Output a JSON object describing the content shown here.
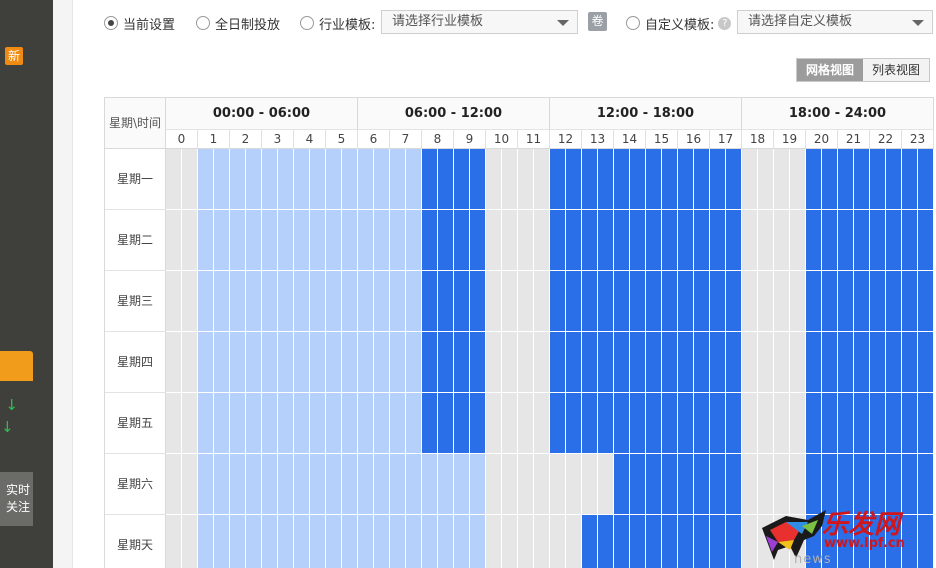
{
  "sidebar": {
    "new_badge": "新",
    "arrows": [
      "↓",
      "↓"
    ],
    "button_text": "实时\n关注"
  },
  "top_row": {
    "options": [
      {
        "label": "当前设置",
        "checked": true
      },
      {
        "label": "全日制投放",
        "checked": false
      },
      {
        "label": "行业模板:",
        "checked": false
      },
      {
        "label": "自定义模板:",
        "checked": false
      }
    ],
    "industry_select_placeholder": "请选择行业模板",
    "custom_select_placeholder": "请选择自定义模板",
    "tag_label": "卷",
    "help_icon": "?"
  },
  "view_toggle": {
    "grid_label": "网格视图",
    "list_label": "列表视图",
    "active": "grid"
  },
  "grid": {
    "corner_label": "星期\\时间",
    "hour_groups": [
      "00:00 - 06:00",
      "06:00 - 12:00",
      "12:00 - 18:00",
      "18:00 - 24:00"
    ],
    "hours": [
      "0",
      "1",
      "2",
      "3",
      "4",
      "5",
      "6",
      "7",
      "8",
      "9",
      "10",
      "11",
      "12",
      "13",
      "14",
      "15",
      "16",
      "17",
      "18",
      "19",
      "20",
      "21",
      "22",
      "23"
    ],
    "days": [
      "星期一",
      "星期二",
      "星期三",
      "星期四",
      "星期五",
      "星期六",
      "星期天"
    ],
    "legend_colors": {
      "off": "#e6e6e6",
      "light": "#b5d0fb",
      "full": "#2a6fe7"
    },
    "schedule": [
      [
        0,
        1,
        1,
        1,
        1,
        1,
        1,
        1,
        2,
        2,
        0,
        0,
        2,
        2,
        2,
        2,
        2,
        2,
        0,
        0,
        2,
        2,
        2,
        2
      ],
      [
        0,
        1,
        1,
        1,
        1,
        1,
        1,
        1,
        2,
        2,
        0,
        0,
        2,
        2,
        2,
        2,
        2,
        2,
        0,
        0,
        2,
        2,
        2,
        2
      ],
      [
        0,
        1,
        1,
        1,
        1,
        1,
        1,
        1,
        2,
        2,
        0,
        0,
        2,
        2,
        2,
        2,
        2,
        2,
        0,
        0,
        2,
        2,
        2,
        2
      ],
      [
        0,
        1,
        1,
        1,
        1,
        1,
        1,
        1,
        2,
        2,
        0,
        0,
        2,
        2,
        2,
        2,
        2,
        2,
        0,
        0,
        2,
        2,
        2,
        2
      ],
      [
        0,
        1,
        1,
        1,
        1,
        1,
        1,
        1,
        2,
        2,
        0,
        0,
        2,
        2,
        2,
        2,
        2,
        2,
        0,
        0,
        2,
        2,
        2,
        2
      ],
      [
        0,
        1,
        1,
        1,
        1,
        1,
        1,
        1,
        1,
        1,
        0,
        0,
        0,
        0,
        2,
        2,
        2,
        2,
        0,
        0,
        2,
        2,
        2,
        2
      ],
      [
        0,
        1,
        1,
        1,
        1,
        1,
        1,
        1,
        1,
        1,
        0,
        0,
        0,
        2,
        2,
        2,
        2,
        2,
        0,
        0,
        2,
        2,
        2,
        2
      ]
    ]
  },
  "watermark": {
    "brand": "乐发网",
    "url": "www.lpf.cn",
    "sub": "news"
  }
}
